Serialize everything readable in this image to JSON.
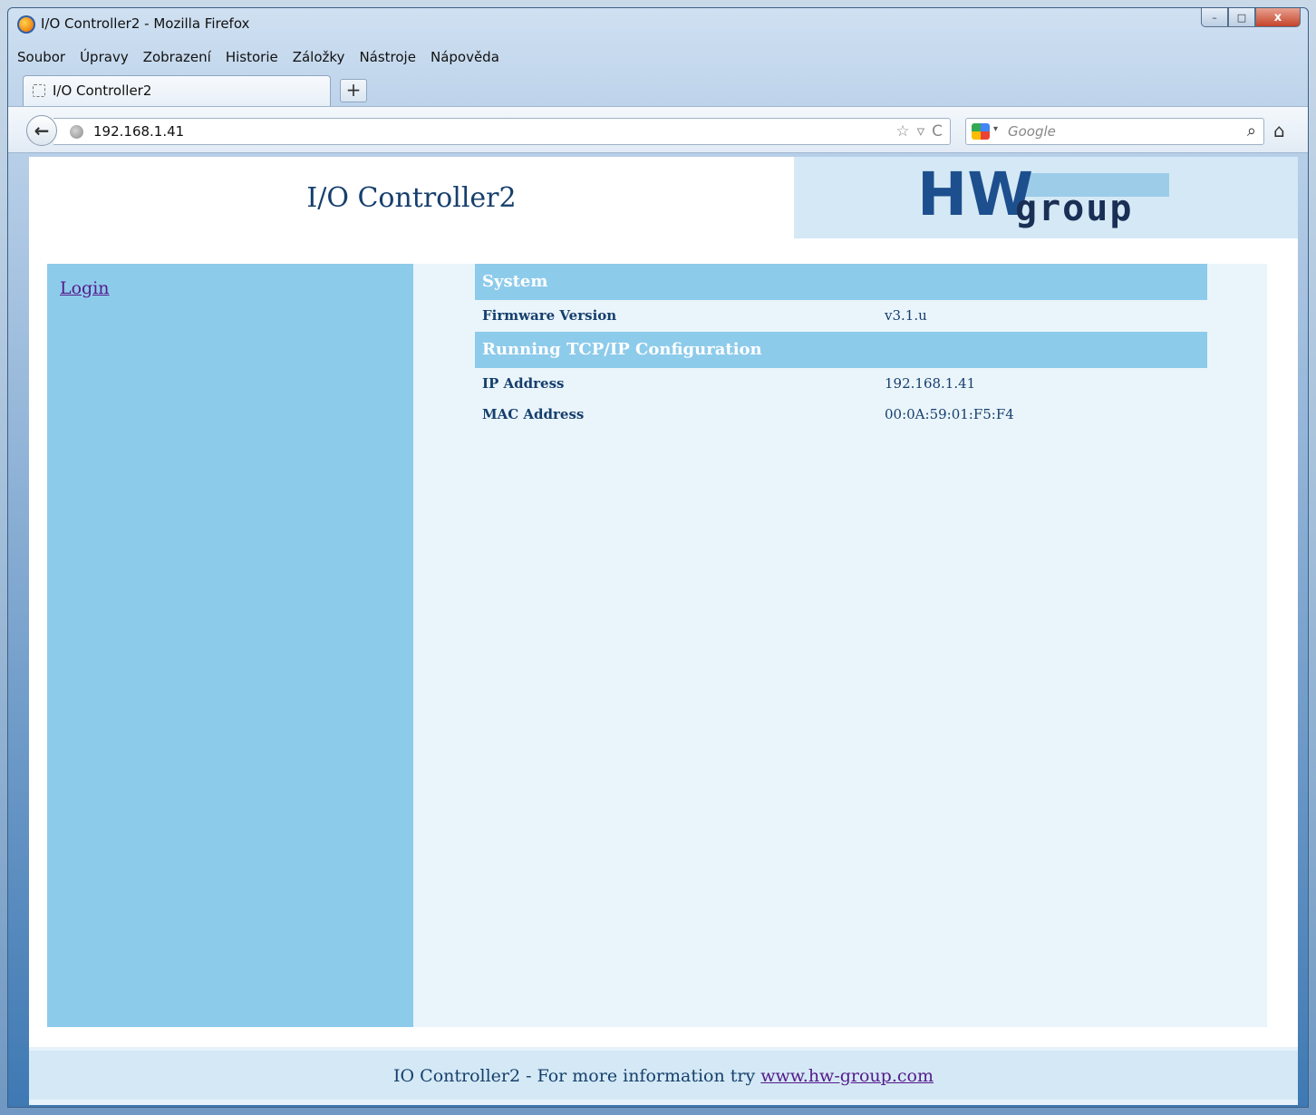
{
  "window": {
    "title": "I/O Controller2 - Mozilla Firefox",
    "controls": {
      "minimize": "–",
      "maximize": "□",
      "close": "x"
    }
  },
  "menubar": {
    "items": [
      "Soubor",
      "Úpravy",
      "Zobrazení",
      "Historie",
      "Záložky",
      "Nástroje",
      "Nápověda"
    ]
  },
  "tabs": [
    {
      "label": "I/O Controller2"
    }
  ],
  "newtab_label": "+",
  "navbar": {
    "back_icon": "←",
    "url": "192.168.1.41",
    "bookmark_icon": "☆",
    "dropdown_icon": "▿",
    "reload_icon": "C",
    "search_placeholder": "Google",
    "search_icon": "⌕",
    "home_icon": "⌂"
  },
  "page": {
    "title": "I/O Controller2",
    "logo": {
      "main": "HW",
      "sub": "group"
    },
    "sidebar": {
      "login": "Login"
    },
    "sections": [
      {
        "heading": "System",
        "rows": [
          {
            "label": "Firmware Version",
            "value": "v3.1.u"
          }
        ]
      },
      {
        "heading": "Running TCP/IP Configuration",
        "rows": [
          {
            "label": "IP Address",
            "value": "192.168.1.41"
          },
          {
            "label": "MAC Address",
            "value": "00:0A:59:01:F5:F4"
          }
        ]
      }
    ],
    "footer": {
      "text": "IO Controller2 - For more information try ",
      "link": "www.hw-group.com"
    }
  },
  "colors": {
    "sidebar": "#8dcbeb",
    "content_bg": "#eaf5fb",
    "text": "#163f6d",
    "logo_blue": "#1d4f8e",
    "link_visited": "#551a8b"
  }
}
